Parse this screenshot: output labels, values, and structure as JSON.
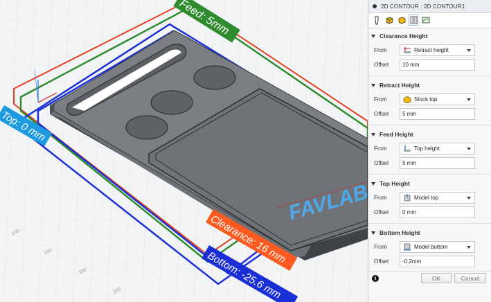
{
  "viewport": {
    "labels": {
      "feed": "Feed: 5mm",
      "top": "Top: 0 mm",
      "clearance": "Clearance: 16 mm",
      "bottom": "Bottom: -25.6 mm"
    },
    "model_text": "FAVLAB",
    "grid_ticks": [
      "150",
      "100",
      "150",
      "200"
    ],
    "colors": {
      "feed": "#2e8b2e",
      "top": "#1e9be0",
      "clearance": "#ff5a1f",
      "bottom": "#1a2fd6",
      "retract": "#e04020"
    }
  },
  "panel": {
    "title": "2D CONTOUR : 2D CONTOUR1",
    "tabs": [
      "tool-icon",
      "geometry-icon",
      "heights-icon",
      "passes-icon",
      "linking-icon"
    ],
    "sections": [
      {
        "header": "Clearance Height",
        "from_label": "From",
        "from_value": "Retract height",
        "offset_label": "Offset",
        "offset_value": "10 mm"
      },
      {
        "header": "Retract Height",
        "from_label": "From",
        "from_value": "Stock top",
        "offset_label": "Offset",
        "offset_value": "5 mm"
      },
      {
        "header": "Feed Height",
        "from_label": "From",
        "from_value": "Top height",
        "offset_label": "Offset",
        "offset_value": "5 mm"
      },
      {
        "header": "Top Height",
        "from_label": "From",
        "from_value": "Model top",
        "offset_label": "Offset",
        "offset_value": "0 mm"
      },
      {
        "header": "Bottom Height",
        "from_label": "From",
        "from_value": "Model bottom",
        "offset_label": "Offset",
        "offset_value": "-0.2mm"
      }
    ],
    "info_icon": "i",
    "ok_label": "OK",
    "cancel_label": "Cancel"
  }
}
